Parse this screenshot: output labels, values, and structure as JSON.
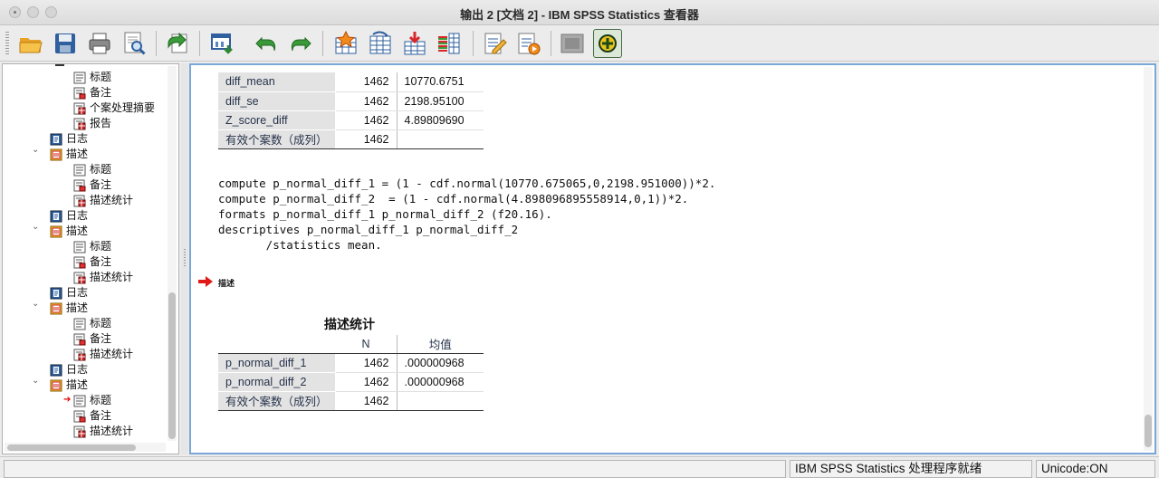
{
  "window": {
    "title": "输出 2 [文档 2] - IBM SPSS Statistics 查看器"
  },
  "toolbar": {
    "buttons": [
      "open-icon",
      "save-icon",
      "print-icon",
      "print-preview-icon",
      "export-icon",
      "recall-dialog-icon",
      "undo-icon",
      "redo-icon",
      "goto-case-icon",
      "goto-variable-icon",
      "insert-cases-icon",
      "variables-icon",
      "create-edit-icon",
      "run-script-icon",
      "designate-window-icon",
      "new-output-icon"
    ]
  },
  "outline": {
    "nodes": [
      {
        "label": "标题",
        "icon": "title-icon"
      },
      {
        "label": "备注",
        "icon": "notes-icon"
      },
      {
        "label": "个案处理摘要",
        "icon": "table-icon"
      },
      {
        "label": "报告",
        "icon": "table-icon"
      },
      {
        "label": "日志",
        "icon": "log-icon"
      },
      {
        "label": "描述",
        "icon": "procedure-icon"
      },
      {
        "label": "标题",
        "icon": "title-icon"
      },
      {
        "label": "备注",
        "icon": "notes-icon"
      },
      {
        "label": "描述统计",
        "icon": "table-icon"
      },
      {
        "label": "日志",
        "icon": "log-icon"
      },
      {
        "label": "描述",
        "icon": "procedure-icon"
      },
      {
        "label": "标题",
        "icon": "title-icon"
      },
      {
        "label": "备注",
        "icon": "notes-icon"
      },
      {
        "label": "描述统计",
        "icon": "table-icon"
      },
      {
        "label": "日志",
        "icon": "log-icon"
      },
      {
        "label": "描述",
        "icon": "procedure-icon"
      },
      {
        "label": "标题",
        "icon": "title-icon"
      },
      {
        "label": "备注",
        "icon": "notes-icon"
      },
      {
        "label": "描述统计",
        "icon": "table-icon"
      },
      {
        "label": "日志",
        "icon": "log-icon"
      },
      {
        "label": "描述",
        "icon": "procedure-icon"
      },
      {
        "label": "标题",
        "icon": "title-icon"
      },
      {
        "label": "备注",
        "icon": "notes-icon"
      },
      {
        "label": "描述统计",
        "icon": "table-icon"
      }
    ]
  },
  "upper_table": {
    "rows": [
      {
        "label": "diff_mean",
        "n": "1462",
        "value": "10770.6751"
      },
      {
        "label": "diff_se",
        "n": "1462",
        "value": "2198.95100"
      },
      {
        "label": "Z_score_diff",
        "n": "1462",
        "value": "4.89809690"
      },
      {
        "label": "有效个案数（成列）",
        "n": "1462",
        "value": ""
      }
    ]
  },
  "syntax": {
    "line1": "compute p_normal_diff_1 = (1 - cdf.normal(10770.675065,0,2198.951000))*2.",
    "line2": "compute p_normal_diff_2  = (1 - cdf.normal(4.898096895558914,0,1))*2.",
    "line3": "formats p_normal_diff_1 p_normal_diff_2 (f20.16).",
    "line4": "descriptives p_normal_diff_1 p_normal_diff_2",
    "line5": "       /statistics mean."
  },
  "procedure_label": "描述",
  "desc_table": {
    "title": "描述统计",
    "col_n": "N",
    "col_mean": "均值",
    "rows": [
      {
        "label": "p_normal_diff_1",
        "n": "1462",
        "value": ".000000968"
      },
      {
        "label": "p_normal_diff_2",
        "n": "1462",
        "value": ".000000968"
      },
      {
        "label": "有效个案数（成列）",
        "n": "1462",
        "value": ""
      }
    ]
  },
  "status": {
    "message": "IBM SPSS Statistics 处理程序就绪",
    "unicode": "Unicode:ON"
  }
}
